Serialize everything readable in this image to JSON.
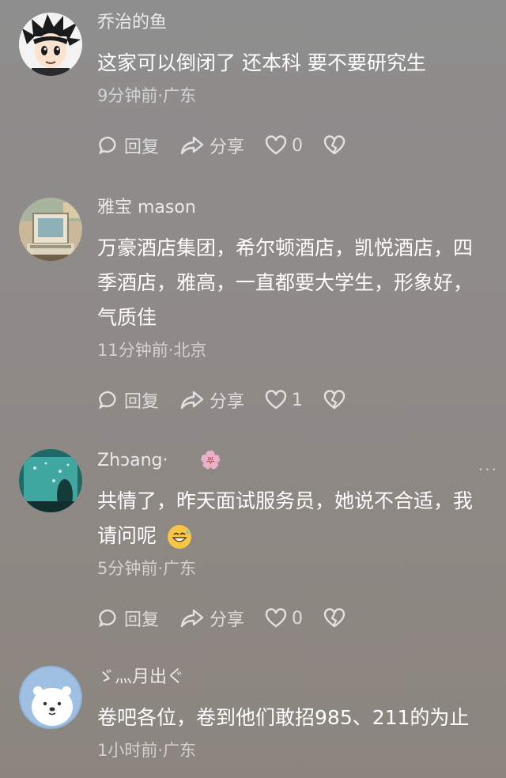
{
  "colors": {
    "background_top": "#8e8e8e",
    "background_bottom": "#8c857f",
    "text": "#ffffff"
  },
  "actions": {
    "reply_label": "回复",
    "share_label": "分享"
  },
  "comments": [
    {
      "username": "乔治的鱼",
      "text": "这家可以倒闭了   还本科 要不要研究生",
      "meta": "9分钟前·广东",
      "likes": "0",
      "avatar": "cartoon-spiky-hair-avatar"
    },
    {
      "username": "雅宝 mason",
      "text": "万豪酒店集团，希尔顿酒店，凯悦酒店，四季酒店，雅高，一直都要大学生，形象好，气质佳",
      "meta": "11分钟前·北京",
      "likes": "1",
      "avatar": "retro-computer-avatar"
    },
    {
      "username": "Zhɔang·",
      "username_emoji": "🌸",
      "text": "共情了，昨天面试服务员，她说不合适，我请问呢",
      "emoji_name": "sweat-smile-emoji",
      "meta": "5分钟前·广东",
      "likes": "0",
      "avatar": "aquarium-avatar",
      "more": "···"
    },
    {
      "username": "ゞ灬月出ぐ",
      "text": "卷吧各位，卷到他们敢招985、211的为止",
      "meta": "1小时前·广东",
      "avatar": "polar-bear-avatar"
    }
  ]
}
